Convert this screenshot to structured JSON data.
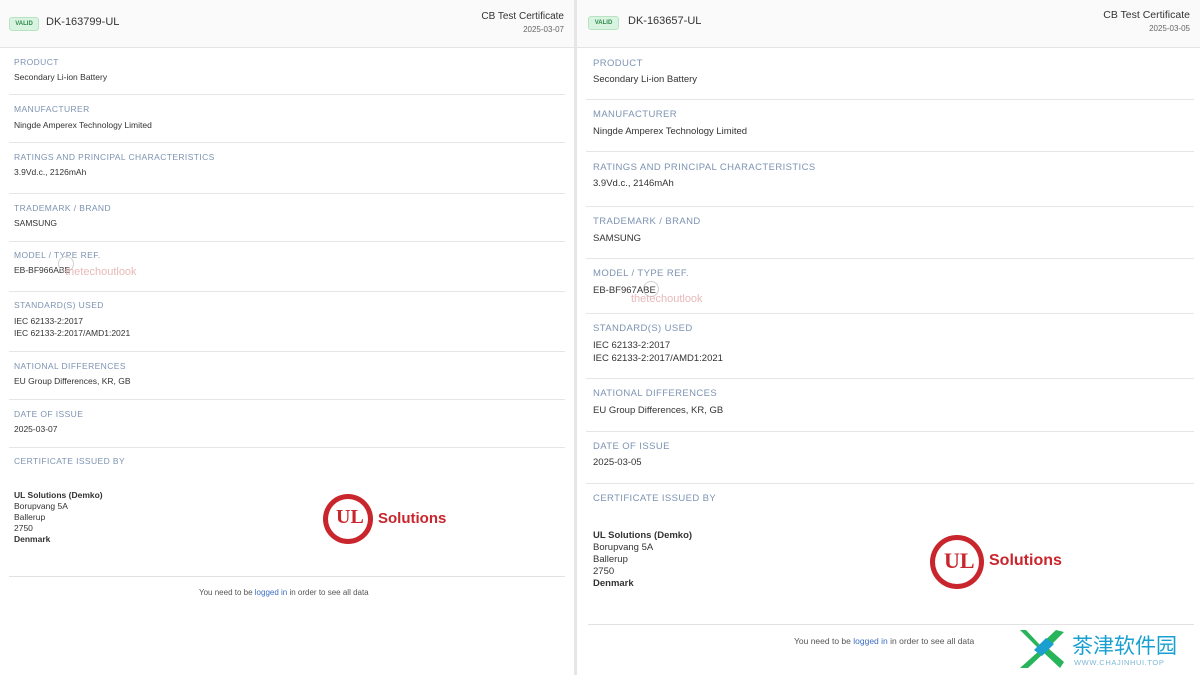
{
  "left": {
    "badge": "VALID",
    "cert_id": "DK-163799-UL",
    "cert_type": "CB Test Certificate",
    "cert_date": "2025-03-07",
    "product_label": "PRODUCT",
    "product_value": "Secondary Li-ion Battery",
    "manufacturer_label": "MANUFACTURER",
    "manufacturer_value": "Ningde Amperex Technology Limited",
    "ratings_label": "RATINGS AND PRINCIPAL CHARACTERISTICS",
    "ratings_value": "3.9Vd.c., 2126mAh",
    "trademark_label": "TRADEMARK / BRAND",
    "trademark_value": "SAMSUNG",
    "model_label": "MODEL / TYPE REF.",
    "model_value": "EB-BF966ABE",
    "standards_label": "STANDARD(S) USED",
    "standards_values": [
      "IEC 62133-2:2017",
      "IEC 62133-2:2017/AMD1:2021"
    ],
    "national_label": "NATIONAL DIFFERENCES",
    "national_value": "EU Group Differences,  KR,  GB",
    "date_label": "DATE OF ISSUE",
    "date_value": "2025-03-07",
    "issued_label": "CERTIFICATE ISSUED BY",
    "issuer": [
      "UL Solutions (Demko)",
      "Borupvang 5A",
      "Ballerup",
      "2750",
      "Denmark"
    ],
    "logo_text": "Solutions",
    "logo_letters": "UL",
    "footer_pre": "You need to be ",
    "footer_link": "logged in",
    "footer_post": " in order to see all data",
    "watermark": "thetechoutlook"
  },
  "right": {
    "badge": "VALID",
    "cert_id": "DK-163657-UL",
    "cert_type": "CB Test Certificate",
    "cert_date": "2025-03-05",
    "product_label": "PRODUCT",
    "product_value": "Secondary Li-ion Battery",
    "manufacturer_label": "MANUFACTURER",
    "manufacturer_value": "Ningde Amperex Technology Limited",
    "ratings_label": "RATINGS AND PRINCIPAL CHARACTERISTICS",
    "ratings_value": "3.9Vd.c., 2146mAh",
    "trademark_label": "TRADEMARK / BRAND",
    "trademark_value": "SAMSUNG",
    "model_label": "MODEL / TYPE REF.",
    "model_value": "EB-BF967ABE",
    "standards_label": "STANDARD(S) USED",
    "standards_values": [
      "IEC 62133-2:2017",
      "IEC 62133-2:2017/AMD1:2021"
    ],
    "national_label": "NATIONAL DIFFERENCES",
    "national_value": "EU Group Differences,  KR,  GB",
    "date_label": "DATE OF ISSUE",
    "date_value": "2025-03-05",
    "issued_label": "CERTIFICATE ISSUED BY",
    "issuer": [
      "UL Solutions (Demko)",
      "Borupvang 5A",
      "Ballerup",
      "2750",
      "Denmark"
    ],
    "logo_text": "Solutions",
    "logo_letters": "UL",
    "footer_pre": "You need to be ",
    "footer_link": "logged in",
    "footer_post": " in order to see all data",
    "watermark": "thetechoutlook"
  },
  "corner_watermark": {
    "cn_text": "茶津软件园",
    "url_text": "WWW.CHAJINHUI.TOP"
  },
  "colors": {
    "label": "#7d93b2",
    "badge_bg": "#d8f3df",
    "badge_text": "#2f8a4c",
    "ul_red": "#c9252c",
    "link": "#3b6cc3"
  }
}
